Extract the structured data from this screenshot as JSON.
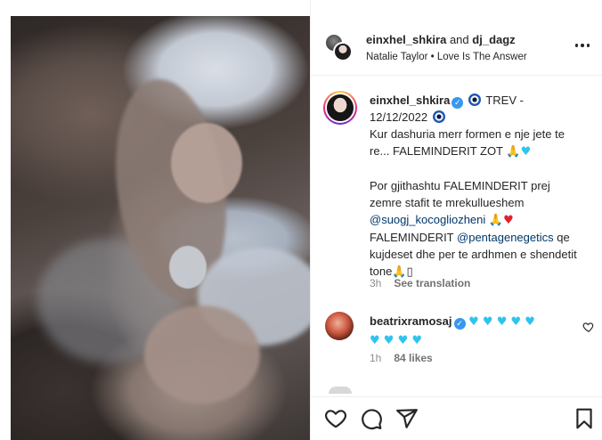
{
  "post": {
    "header": {
      "username1": "einxhel_shkira",
      "and_text": "and",
      "username2": "dj_dagz",
      "subtitle": "Natalie Taylor • Love Is The Answer"
    },
    "caption": {
      "username": "einxhel_shkira",
      "title_text": "TREV -",
      "date_text": "12/12/2022",
      "line1": "Kur dashuria merr formen e nje jete te re... FALEMINDERIT ZOT",
      "line1_emojis": "🙏",
      "line1_heart": "♥",
      "para2_a": "Por gjithashtu FALEMINDERIT prej zemre stafit te mrekullueshem",
      "mention1": "@suogj_kocogliozheni",
      "para2_emojis": "🙏",
      "para2_heart": "♥",
      "para2_b": "FALEMINDERIT",
      "mention2": "@pentagenegetics",
      "para2_c": "qe kujdeset dhe per te ardhmen e shendetit tone",
      "para2_end": "🙏▯",
      "time": "3h",
      "see_translation": "See translation"
    },
    "comment": {
      "username": "beatrixramosaj",
      "hearts_line1": "♥ ♥ ♥ ♥ ♥",
      "hearts_line2": "♥ ♥ ♥ ♥",
      "time": "1h",
      "likes": "84 likes"
    }
  },
  "colors": {
    "verified": "#3897f0",
    "mention": "#00376b",
    "heart_blue": "#2ec4ef",
    "heart_red": "#e0202f",
    "meta_gray": "#8e8e8e"
  },
  "icons": [
    "more-options-icon",
    "verified-badge-icon",
    "evil-eye-emoji",
    "like-comment-icon",
    "heart-icon",
    "comment-icon",
    "share-icon",
    "save-icon"
  ]
}
